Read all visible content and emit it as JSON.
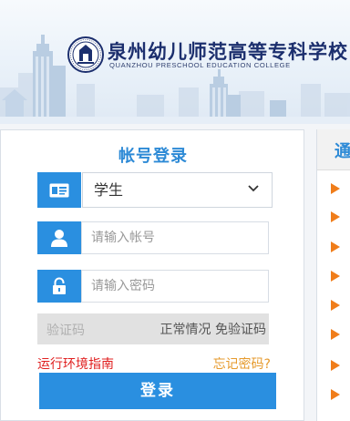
{
  "header": {
    "school_name_cn": "泉州幼儿师范高等专科学校",
    "school_name_en": "QUANZHOU PRESCHOOL EDUCATION COLLEGE"
  },
  "login": {
    "title": "帐号登录",
    "role_selected": "学生",
    "account_placeholder": "请输入帐号",
    "password_placeholder": "请输入密码",
    "captcha_placeholder": "验证码",
    "captcha_status": "正常情况 免验证码",
    "env_guide_link": "运行环境指南",
    "forgot_password_link": "忘记密码?",
    "submit_label": "登录"
  },
  "notice": {
    "title_visible": "通"
  },
  "colors": {
    "accent": "#2a8fe0",
    "title_blue": "#2d8ad6",
    "link_red": "#e02020",
    "link_orange": "#e69a2c",
    "bullet_orange": "#f07d1a"
  },
  "icons": {
    "role": "id-card-icon",
    "account": "user-icon",
    "password": "lock-icon",
    "select": "chevron-down-icon",
    "notice_bullet": "play-arrow-icon"
  }
}
